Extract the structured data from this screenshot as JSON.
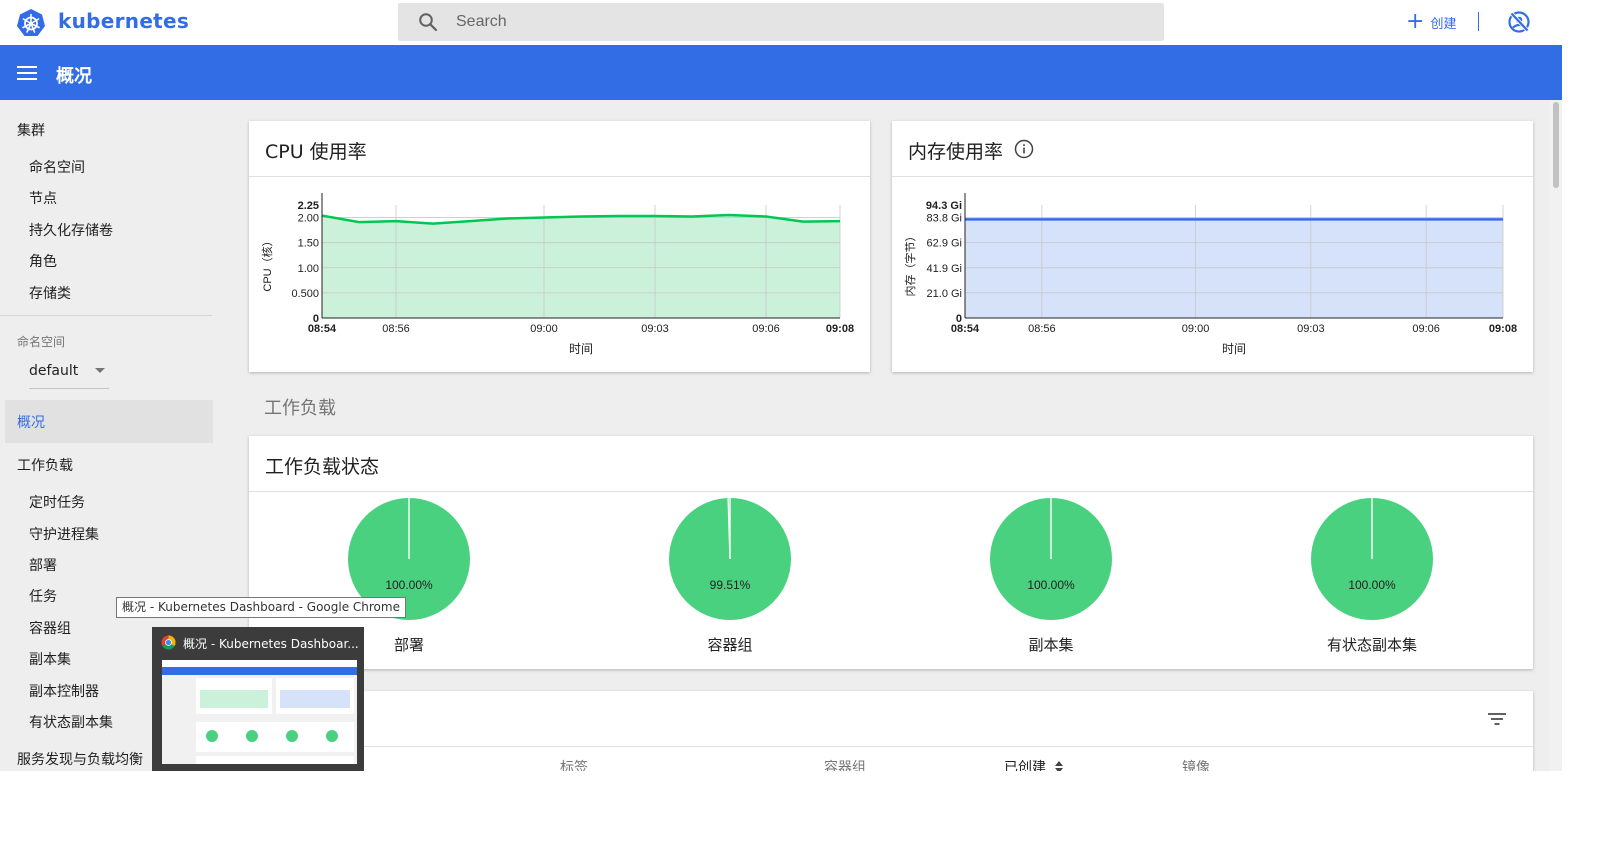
{
  "app": {
    "brand": "kubernetes"
  },
  "search": {
    "placeholder": "Search"
  },
  "topbar": {
    "create_label": "创建"
  },
  "header": {
    "title": "概况"
  },
  "sidebar": {
    "cluster": "集群",
    "cluster_items": [
      "命名空间",
      "节点",
      "持久化存储卷",
      "角色",
      "存储类"
    ],
    "namespace_label": "命名空间",
    "namespace_value": "default",
    "overview": "概况",
    "workloads": "工作负载",
    "workload_items": [
      "定时任务",
      "守护进程集",
      "部署",
      "任务",
      "容器组",
      "副本集",
      "副本控制器",
      "有状态副本集"
    ],
    "discovery": "服务发现与负载均衡"
  },
  "cpu_card": {
    "title": "CPU 使用率"
  },
  "mem_card": {
    "title": "内存使用率"
  },
  "workloads_section": "工作负载",
  "status_card": {
    "title": "工作负载状态",
    "pies": [
      {
        "label": "部署",
        "percent_text": "100.00%",
        "percent": 100.0
      },
      {
        "label": "容器组",
        "percent_text": "99.51%",
        "percent": 99.51
      },
      {
        "label": "副本集",
        "percent_text": "100.00%",
        "percent": 100.0
      },
      {
        "label": "有状态副本集",
        "percent_text": "100.00%",
        "percent": 100.0
      }
    ]
  },
  "table_card": {
    "columns": [
      "标签",
      "容器组",
      "已创建",
      "镜像"
    ]
  },
  "tooltip": "概况 - Kubernetes Dashboard - Google Chrome",
  "taskbar_preview": {
    "title": "概况 - Kubernetes Dashboar..."
  },
  "chart_data": [
    {
      "type": "area",
      "title": "CPU 使用率",
      "xlabel": "时间",
      "ylabel": "CPU（核）",
      "x_ticks": [
        "08:54",
        "08:56",
        "09:00",
        "09:03",
        "09:06",
        "09:08"
      ],
      "y_ticks": [
        "0",
        "0.500",
        "1.00",
        "1.50",
        "2.00",
        "2.25"
      ],
      "ylim": [
        0,
        2.25
      ],
      "x": [
        "08:54",
        "08:55",
        "08:56",
        "08:57",
        "08:58",
        "08:59",
        "09:00",
        "09:01",
        "09:02",
        "09:03",
        "09:04",
        "09:05",
        "09:06",
        "09:07",
        "09:08"
      ],
      "values": [
        2.04,
        1.91,
        1.93,
        1.88,
        1.93,
        1.98,
        2.0,
        2.02,
        2.03,
        2.03,
        2.02,
        2.05,
        2.02,
        1.92,
        1.93
      ],
      "color": "#00c752",
      "fill": "#cbf1db",
      "grid": true
    },
    {
      "type": "area",
      "title": "内存使用率",
      "xlabel": "时间",
      "ylabel": "内存（字节）",
      "x_ticks": [
        "08:54",
        "08:56",
        "09:00",
        "09:03",
        "09:06",
        "09:08"
      ],
      "y_ticks": [
        "0",
        "21.0 Gi",
        "41.9 Gi",
        "62.9 Gi",
        "83.8 Gi",
        "94.3 Gi"
      ],
      "ylim": [
        0,
        94.3
      ],
      "x": [
        "08:54",
        "08:56",
        "09:00",
        "09:03",
        "09:06",
        "09:08"
      ],
      "values": [
        82.3,
        82.3,
        82.3,
        82.3,
        82.3,
        82.3
      ],
      "unit": "Gi",
      "color": "#326de6",
      "fill": "#d6e2fa",
      "grid": true
    }
  ],
  "colors": {
    "primary": "#326de6",
    "success": "#4ad17f"
  }
}
